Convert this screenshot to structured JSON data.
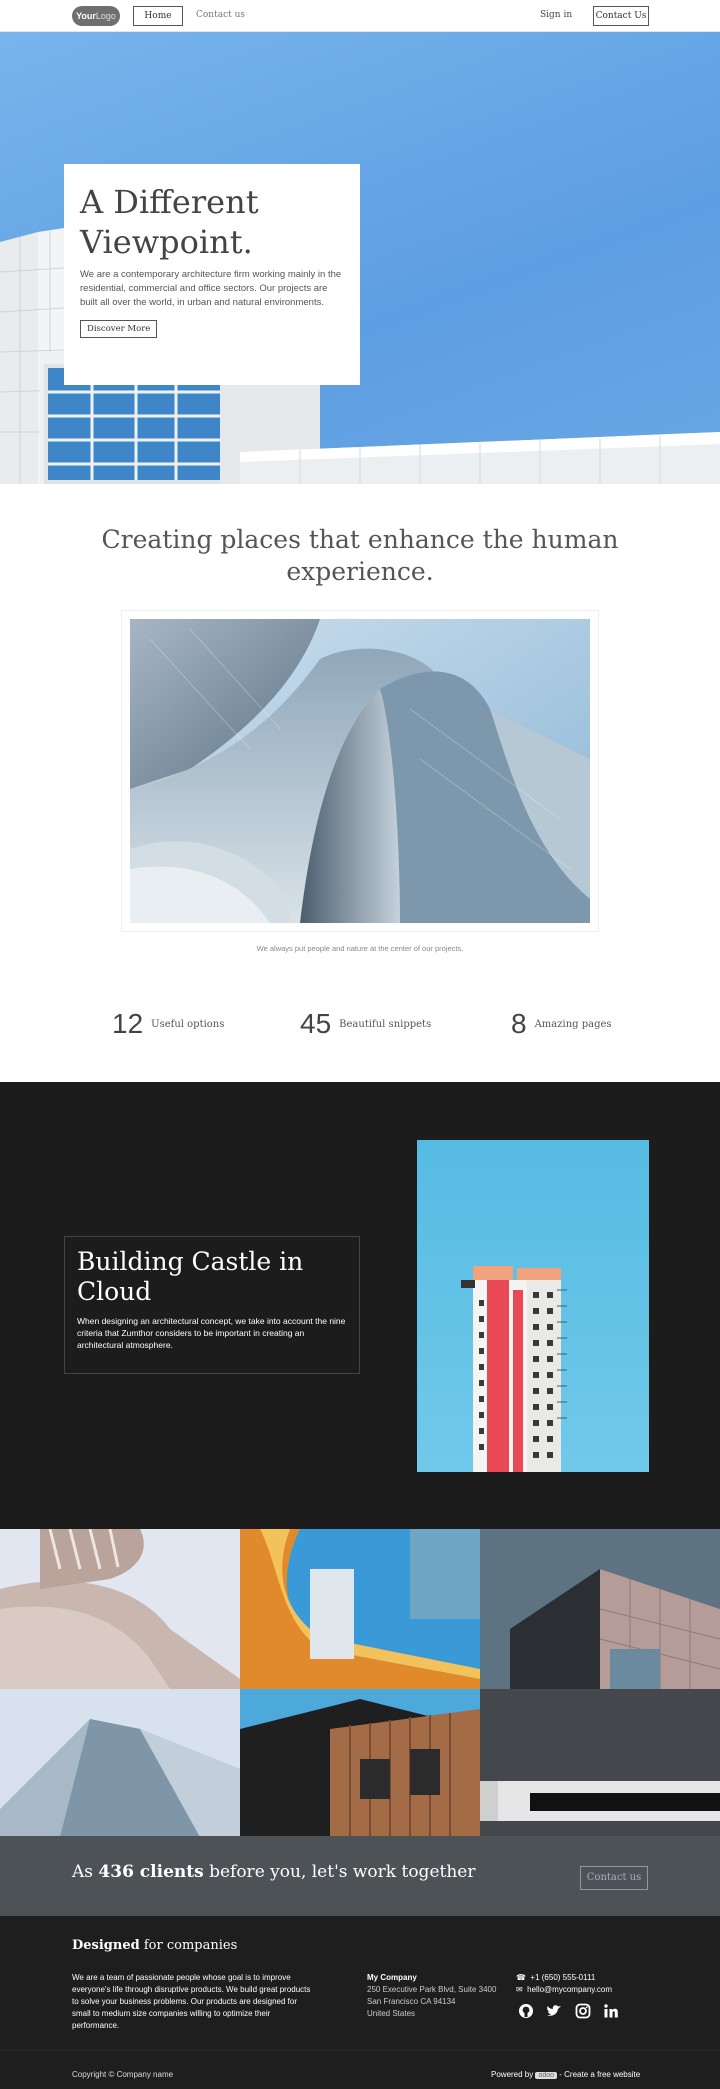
{
  "nav": {
    "logo_part1": "Your",
    "logo_part2": "Logo",
    "home_label": "Home",
    "contact_label": "Contact us",
    "signin_label": "Sign in",
    "cta_label": "Contact Us"
  },
  "hero": {
    "title_line1": "A Different",
    "title_line2": "Viewpoint.",
    "text": "We are a contemporary architecture firm working mainly in the residential, commercial and office sectors. Our projects are built all over the world, in urban and natural environments.",
    "button_label": "Discover More"
  },
  "section2": {
    "headline": "Creating places that enhance the human experience.",
    "caption": "We always put people and nature at the center of our projects."
  },
  "stats": [
    {
      "number": "12",
      "label": "Useful options"
    },
    {
      "number": "45",
      "label": "Beautiful snippets"
    },
    {
      "number": "8",
      "label": "Amazing pages"
    }
  ],
  "dark": {
    "title": "Building Castle in Cloud",
    "text": "When designing an architectural concept, we take into account the nine criteria that Zumthor considers to be important in creating an architectural atmosphere."
  },
  "cta": {
    "prefix": "As ",
    "bold": "436 clients",
    "suffix": " before you, let's work together",
    "button_label": "Contact us"
  },
  "footer": {
    "title_bold": "Designed",
    "title_rest": " for companies",
    "description": "We are a team of passionate people whose goal is to improve everyone's life through disruptive products. We build great products to solve your business problems. Our products are designed for small to medium size companies willing to optimize their performance.",
    "company": "My Company",
    "address_line1": "250 Executive Park Blvd, Suite 3400",
    "address_line2": "San Francisco CA 94134",
    "address_line3": "United States",
    "phone": "+1 (650) 555-0111",
    "email": "hello@mycompany.com",
    "copyright": "Copyright © Company name",
    "powered_prefix": "Powered by ",
    "powered_badge": "odoo",
    "powered_suffix": " - Create a free website"
  }
}
